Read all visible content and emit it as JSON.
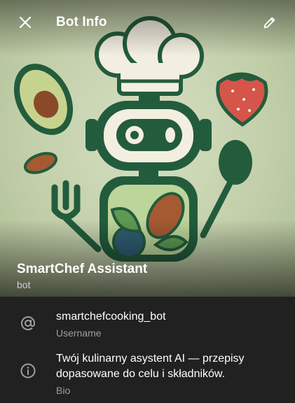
{
  "topbar": {
    "title": "Bot Info",
    "close_icon": "close-icon",
    "edit_icon": "pencil-icon"
  },
  "profile": {
    "name": "SmartChef Assistant",
    "status": "bot",
    "avatar": "robot-chef-illustration"
  },
  "info": [
    {
      "icon": "at-icon",
      "value": "smartchefcooking_bot",
      "label": "Username"
    },
    {
      "icon": "info-icon",
      "value": "Twój kulinarny asystent AI — przepisy dopasowane do celu i składników.",
      "label": "Bio"
    }
  ],
  "colors": {
    "background": "#212121",
    "hero_bg": "#c3d0ab",
    "illustration_green": "#235c3c",
    "secondary_text": "#9e9e9e"
  }
}
